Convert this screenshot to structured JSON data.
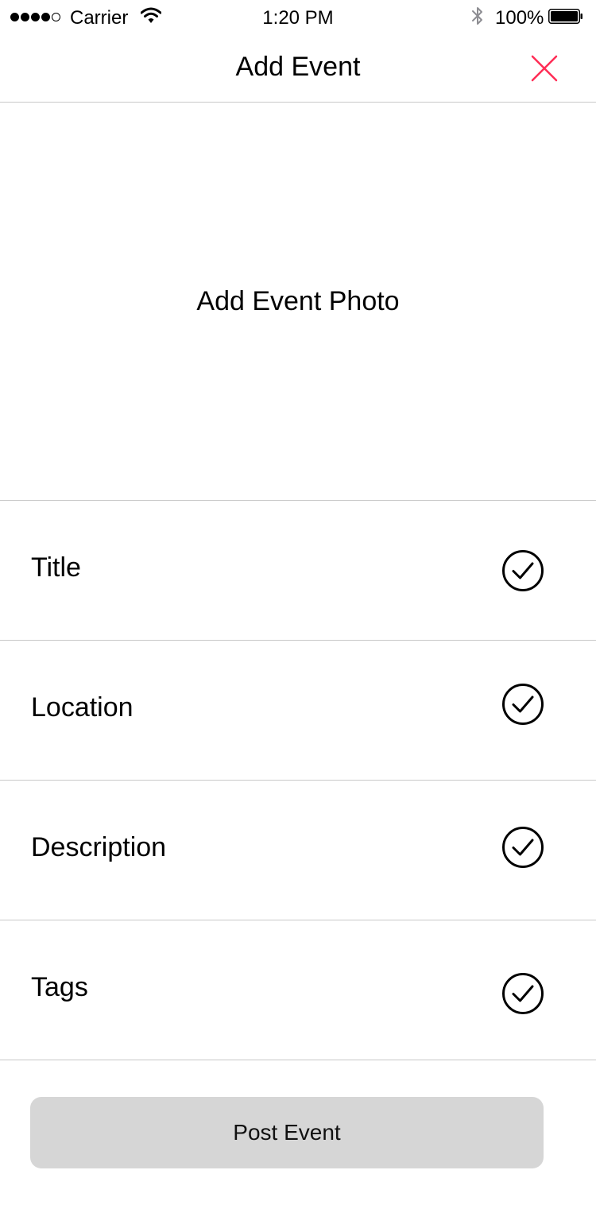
{
  "status_bar": {
    "carrier": "Carrier",
    "time": "1:20 PM",
    "battery": "100%",
    "signal_bars": 4,
    "signal_max": 5,
    "icons": [
      "signal-dots-icon",
      "wifi-icon",
      "bluetooth-icon",
      "battery-icon"
    ]
  },
  "nav": {
    "title": "Add Event",
    "close_icon": "close-icon",
    "close_color": "#ff2d55"
  },
  "photo": {
    "label": "Add Event Photo"
  },
  "form": {
    "rows": [
      {
        "label": "Title",
        "icon": "checkmark-circle-icon"
      },
      {
        "label": "Location",
        "icon": "checkmark-circle-icon"
      },
      {
        "label": "Description",
        "icon": "checkmark-circle-icon"
      },
      {
        "label": "Tags",
        "icon": "checkmark-circle-icon"
      }
    ]
  },
  "post_button": {
    "label": "Post Event",
    "background": "#d6d6d6"
  }
}
